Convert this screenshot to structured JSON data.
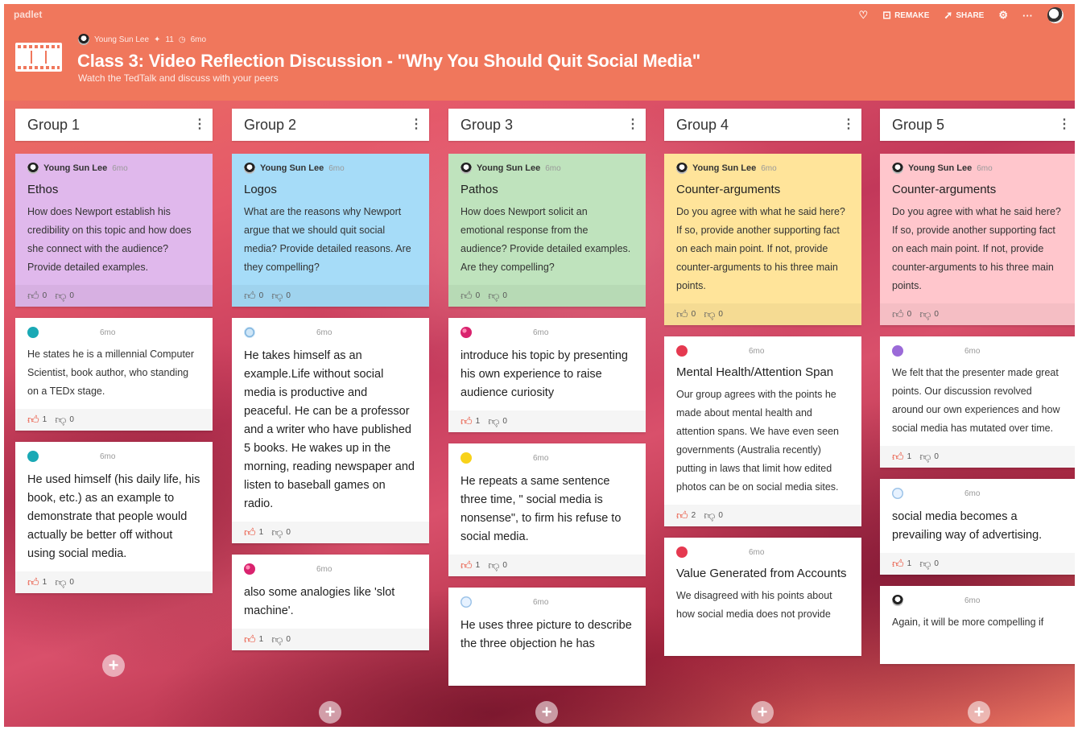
{
  "app": {
    "brand": "padlet"
  },
  "top_actions": {
    "remake": "REMAKE",
    "share": "SHARE"
  },
  "header": {
    "author": "Young Sun Lee",
    "count": "11",
    "age": "6mo",
    "title": "Class 3: Video Reflection Discussion - \"Why You Should Quit Social Media\"",
    "subtitle": "Watch the TedTalk and discuss with your peers"
  },
  "columns": [
    {
      "title": "Group 1",
      "cards": [
        {
          "color": "purple",
          "avatar": "av-user",
          "author": "Young Sun Lee",
          "time": "6mo",
          "title": "Ethos",
          "body": "How does Newport establish his credibility on this topic and how does she connect with the audience? Provide detailed examples.",
          "big": false,
          "likes": "0",
          "dislikes": "0",
          "liked": false
        },
        {
          "color": "",
          "avatar": "av-teal",
          "author": "",
          "time": "6mo",
          "title": "",
          "body": "He states he is a millennial Computer Scientist, book author, who standing on a TEDx stage.",
          "big": false,
          "likes": "1",
          "dislikes": "0",
          "liked": true
        },
        {
          "color": "",
          "avatar": "av-teal",
          "author": "",
          "time": "6mo",
          "title": "",
          "body": "He used himself (his daily life, his book, etc.) as an example to demonstrate that people would actually be better off without using social media.",
          "big": true,
          "likes": "1",
          "dislikes": "0",
          "liked": true
        }
      ]
    },
    {
      "title": "Group 2",
      "cards": [
        {
          "color": "blue",
          "avatar": "av-user",
          "author": "Young Sun Lee",
          "time": "6mo",
          "title": "Logos",
          "body": "What are the reasons why Newport argue that we should quit social media? Provide detailed reasons. Are they compelling?",
          "big": false,
          "likes": "0",
          "dislikes": "0",
          "liked": false
        },
        {
          "color": "",
          "avatar": "av-globe",
          "author": "",
          "time": "6mo",
          "title": "",
          "body": "He takes himself as an example.Life without social media is productive and peaceful. He can be a professor and a writer who have published 5 books. He wakes up in the morning, reading newspaper and listen to baseball games on radio.",
          "big": true,
          "likes": "1",
          "dislikes": "0",
          "liked": true
        },
        {
          "color": "",
          "avatar": "av-berry",
          "author": "",
          "time": "6mo",
          "title": "",
          "body": "also some analogies like 'slot machine'.",
          "big": true,
          "likes": "1",
          "dislikes": "0",
          "liked": true
        }
      ]
    },
    {
      "title": "Group 3",
      "cards": [
        {
          "color": "green",
          "avatar": "av-user",
          "author": "Young Sun Lee",
          "time": "6mo",
          "title": "Pathos",
          "body": "How does Newport solicit an emotional response from the audience? Provide detailed examples. Are they compelling?",
          "big": false,
          "likes": "0",
          "dislikes": "0",
          "liked": false
        },
        {
          "color": "",
          "avatar": "av-berry",
          "author": "",
          "time": "6mo",
          "title": "",
          "body": "introduce his topic by presenting his own experience to raise audience curiosity",
          "big": true,
          "likes": "1",
          "dislikes": "0",
          "liked": true
        },
        {
          "color": "",
          "avatar": "av-yellow",
          "author": "",
          "time": "6mo",
          "title": "",
          "body": "He repeats a same sentence three time, \" social media is nonsense\", to firm his refuse to social media.",
          "big": true,
          "likes": "1",
          "dislikes": "0",
          "liked": true
        },
        {
          "color": "",
          "avatar": "av-snow",
          "author": "",
          "time": "6mo",
          "title": "",
          "body": "He uses three picture to describe the three objection he has",
          "big": true,
          "likes": "",
          "dislikes": "",
          "liked": false
        }
      ]
    },
    {
      "title": "Group 4",
      "cards": [
        {
          "color": "yellow",
          "avatar": "av-user",
          "author": "Young Sun Lee",
          "time": "6mo",
          "title": "Counter-arguments",
          "body": "Do you agree with what he said here? If so, provide another supporting fact on each main point. If not, provide counter-arguments to his three main points.",
          "big": false,
          "likes": "0",
          "dislikes": "0",
          "liked": false
        },
        {
          "color": "",
          "avatar": "av-red",
          "author": "",
          "time": "6mo",
          "title": "Mental Health/Attention Span",
          "body": "Our group agrees with the points he made about mental health and attention spans. We have even seen governments (Australia recently) putting in laws that limit how edited photos can be on social media sites.",
          "big": false,
          "likes": "2",
          "dislikes": "0",
          "liked": true
        },
        {
          "color": "",
          "avatar": "av-red",
          "author": "",
          "time": "6mo",
          "title": "Value Generated from Accounts",
          "body": "We disagreed with his points about how social media does not provide",
          "big": false,
          "likes": "",
          "dislikes": "",
          "liked": false
        }
      ]
    },
    {
      "title": "Group 5",
      "cards": [
        {
          "color": "pink",
          "avatar": "av-user",
          "author": "Young Sun Lee",
          "time": "6mo",
          "title": "Counter-arguments",
          "body": "Do you agree with what he said here? If so, provide another supporting fact on each main point. If not, provide counter-arguments to his three main points.",
          "big": false,
          "likes": "0",
          "dislikes": "0",
          "liked": false
        },
        {
          "color": "",
          "avatar": "av-violet",
          "author": "",
          "time": "6mo",
          "title": "",
          "body": "We felt that the presenter made great points. Our discussion revolved around our own experiences and how social media has mutated over time.",
          "big": false,
          "likes": "1",
          "dislikes": "0",
          "liked": true
        },
        {
          "color": "",
          "avatar": "av-snow",
          "author": "",
          "time": "6mo",
          "title": "",
          "body": "social media becomes a prevailing way of advertising.",
          "big": true,
          "likes": "1",
          "dislikes": "0",
          "liked": true
        },
        {
          "color": "",
          "avatar": "av-user",
          "author": "",
          "time": "6mo",
          "title": "",
          "body": "Again, it will be more compelling if",
          "big": false,
          "likes": "",
          "dislikes": "",
          "liked": false
        }
      ]
    }
  ]
}
